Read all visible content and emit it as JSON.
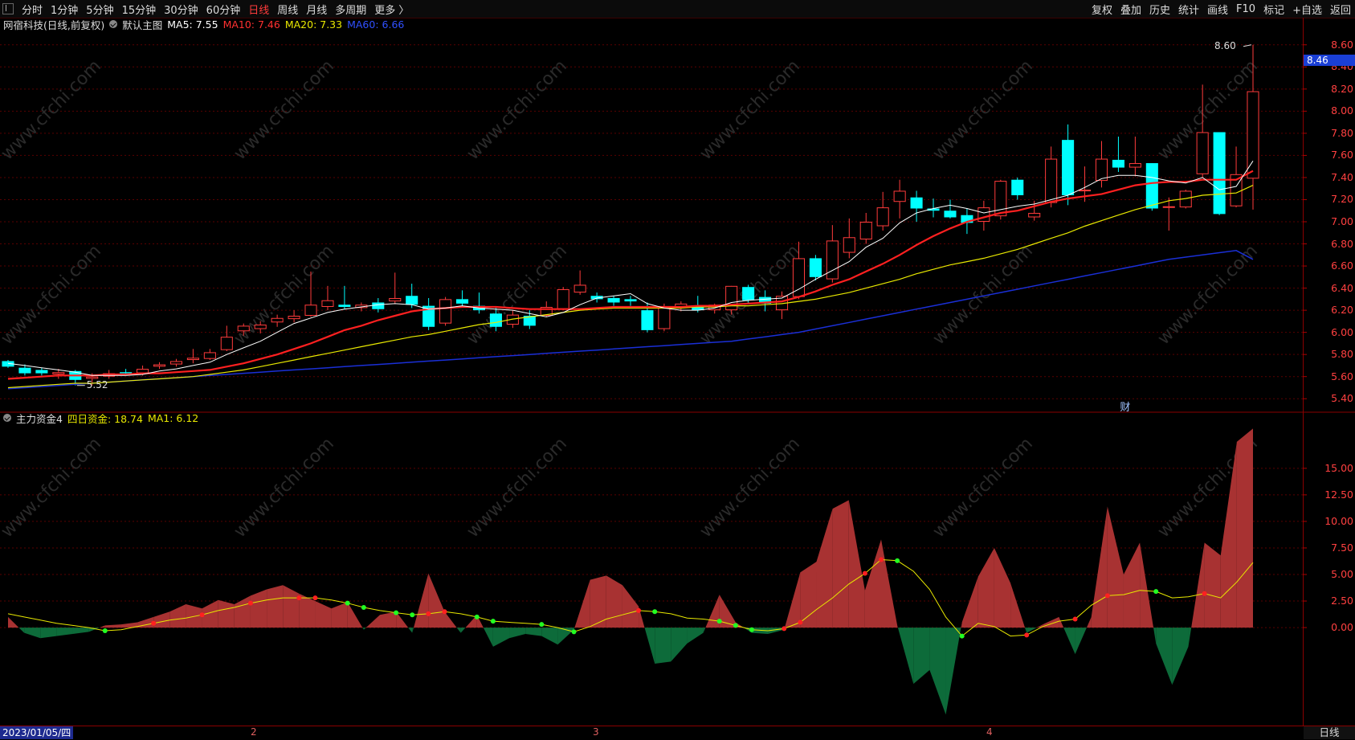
{
  "toolbar": {
    "periods": [
      "分时",
      "1分钟",
      "5分钟",
      "15分钟",
      "30分钟",
      "60分钟",
      "日线",
      "周线",
      "月线",
      "多周期",
      "更多 〉"
    ],
    "active_index": 6,
    "right_items": [
      "复权",
      "叠加",
      "历史",
      "统计",
      "画线",
      "F10",
      "标记",
      "+自选",
      "返回"
    ]
  },
  "main_info": {
    "stock": "网宿科技(日线,前复权)",
    "template": "默认主图",
    "ma5": "MA5: 7.55",
    "ma10": "MA10: 7.46",
    "ma20": "MA20: 7.33",
    "ma60": "MA60: 6.66"
  },
  "sub_info": {
    "indicator": "主力资金4",
    "fund": "四日资金: 18.74",
    "ma1": "MA1: 6.12"
  },
  "price_flag": "8.46",
  "high_marker": "8.60",
  "low_marker": "5.52",
  "finance_marker": "财",
  "bottom": {
    "date": "2023/01/05/四",
    "period": "日线",
    "month_ticks": [
      "2",
      "3",
      "4"
    ]
  },
  "watermark": "www.cfchi.com",
  "colors": {
    "up": "#ff3b3b",
    "down": "#00ffff",
    "ma5": "#ffffff",
    "ma10": "#ff2020",
    "ma20": "#e8e800",
    "ma60": "#1a2fd6",
    "fund_pos": "#a83232",
    "fund_neg": "#0d6b3a",
    "ma1": "#e8e800",
    "grid": "#5a0000"
  },
  "chart_data": [
    {
      "type": "candlestick",
      "title": "网宿科技(日线,前复权)",
      "ylim": [
        5.3,
        8.7
      ],
      "yticks": [
        5.4,
        5.6,
        5.8,
        6.0,
        6.2,
        6.4,
        6.6,
        6.8,
        7.0,
        7.2,
        7.4,
        7.6,
        7.8,
        8.0,
        8.2,
        8.4,
        8.6
      ],
      "candles": [
        [
          5.74,
          5.69,
          5.75,
          5.68
        ],
        [
          5.68,
          5.63,
          5.71,
          5.61
        ],
        [
          5.66,
          5.63,
          5.68,
          5.61
        ],
        [
          5.62,
          5.64,
          5.67,
          5.58
        ],
        [
          5.65,
          5.57,
          5.66,
          5.52
        ],
        [
          5.58,
          5.6,
          5.63,
          5.52
        ],
        [
          5.6,
          5.63,
          5.66,
          5.58
        ],
        [
          5.64,
          5.63,
          5.67,
          5.61
        ],
        [
          5.63,
          5.67,
          5.7,
          5.61
        ],
        [
          5.69,
          5.71,
          5.73,
          5.67
        ],
        [
          5.71,
          5.74,
          5.76,
          5.69
        ],
        [
          5.75,
          5.77,
          5.85,
          5.72
        ],
        [
          5.76,
          5.82,
          5.85,
          5.75
        ],
        [
          5.84,
          5.96,
          6.06,
          5.83
        ],
        [
          6.01,
          6.06,
          6.08,
          5.97
        ],
        [
          6.03,
          6.07,
          6.1,
          5.99
        ],
        [
          6.09,
          6.13,
          6.16,
          6.05
        ],
        [
          6.12,
          6.15,
          6.2,
          6.09
        ],
        [
          6.15,
          6.25,
          6.55,
          6.14
        ],
        [
          6.23,
          6.29,
          6.42,
          6.2
        ],
        [
          6.25,
          6.23,
          6.42,
          6.21
        ],
        [
          6.22,
          6.25,
          6.27,
          6.19
        ],
        [
          6.27,
          6.21,
          6.31,
          6.18
        ],
        [
          6.28,
          6.31,
          6.54,
          6.26
        ],
        [
          6.33,
          6.25,
          6.44,
          6.22
        ],
        [
          6.24,
          6.05,
          6.31,
          6.02
        ],
        [
          6.08,
          6.3,
          6.32,
          6.06
        ],
        [
          6.3,
          6.26,
          6.38,
          6.24
        ],
        [
          6.24,
          6.2,
          6.36,
          6.17
        ],
        [
          6.17,
          6.05,
          6.22,
          6.01
        ],
        [
          6.07,
          6.16,
          6.2,
          6.04
        ],
        [
          6.15,
          6.06,
          6.2,
          6.03
        ],
        [
          6.15,
          6.23,
          6.28,
          6.14
        ],
        [
          6.21,
          6.39,
          6.41,
          6.2
        ],
        [
          6.36,
          6.43,
          6.56,
          6.34
        ],
        [
          6.33,
          6.3,
          6.36,
          6.27
        ],
        [
          6.31,
          6.27,
          6.33,
          6.24
        ],
        [
          6.3,
          6.28,
          6.33,
          6.24
        ],
        [
          6.2,
          6.02,
          6.27,
          6.0
        ],
        [
          6.03,
          6.23,
          6.26,
          6.01
        ],
        [
          6.23,
          6.26,
          6.28,
          6.19
        ],
        [
          6.24,
          6.2,
          6.33,
          6.18
        ],
        [
          6.2,
          6.25,
          6.26,
          6.17
        ],
        [
          6.2,
          6.42,
          6.42,
          6.16
        ],
        [
          6.41,
          6.29,
          6.43,
          6.27
        ],
        [
          6.32,
          6.26,
          6.38,
          6.19
        ],
        [
          6.2,
          6.33,
          6.37,
          6.12
        ],
        [
          6.32,
          6.67,
          6.82,
          6.3
        ],
        [
          6.67,
          6.5,
          6.7,
          6.47
        ],
        [
          6.48,
          6.83,
          6.97,
          6.45
        ],
        [
          6.72,
          6.86,
          7.03,
          6.67
        ],
        [
          6.84,
          7.0,
          7.08,
          6.8
        ],
        [
          6.96,
          7.13,
          7.27,
          6.92
        ],
        [
          7.18,
          7.28,
          7.38,
          7.03
        ],
        [
          7.22,
          7.12,
          7.28,
          7.0
        ],
        [
          7.12,
          7.1,
          7.21,
          7.04
        ],
        [
          7.1,
          7.04,
          7.2,
          7.03
        ],
        [
          7.06,
          6.99,
          7.12,
          6.89
        ],
        [
          7.0,
          7.13,
          7.19,
          6.92
        ],
        [
          7.05,
          7.37,
          7.38,
          7.02
        ],
        [
          7.38,
          7.24,
          7.4,
          7.2
        ],
        [
          7.04,
          7.08,
          7.19,
          7.01
        ],
        [
          7.17,
          7.57,
          7.68,
          7.13
        ],
        [
          7.74,
          7.24,
          7.88,
          7.15
        ],
        [
          7.28,
          7.29,
          7.5,
          7.18
        ],
        [
          7.37,
          7.57,
          7.73,
          7.31
        ],
        [
          7.56,
          7.49,
          7.77,
          7.45
        ],
        [
          7.49,
          7.53,
          7.77,
          7.41
        ],
        [
          7.53,
          7.12,
          7.53,
          7.1
        ],
        [
          7.14,
          7.14,
          7.22,
          6.92
        ],
        [
          7.13,
          7.28,
          7.29,
          7.12
        ],
        [
          7.43,
          7.81,
          8.24,
          7.4
        ],
        [
          7.81,
          7.07,
          7.81,
          7.06
        ],
        [
          7.14,
          7.43,
          7.68,
          7.13
        ],
        [
          7.39,
          8.18,
          8.6,
          7.11
        ]
      ],
      "ma5": [
        5.72,
        5.7,
        5.68,
        5.66,
        5.64,
        5.61,
        5.61,
        5.61,
        5.62,
        5.65,
        5.67,
        5.7,
        5.73,
        5.8,
        5.86,
        5.92,
        6.0,
        6.08,
        6.13,
        6.18,
        6.21,
        6.23,
        6.25,
        6.26,
        6.25,
        6.21,
        6.22,
        6.24,
        6.22,
        6.21,
        6.2,
        6.17,
        6.14,
        6.18,
        6.25,
        6.31,
        6.33,
        6.35,
        6.26,
        6.22,
        6.2,
        6.2,
        6.22,
        6.27,
        6.29,
        6.3,
        6.31,
        6.39,
        6.48,
        6.56,
        6.64,
        6.77,
        6.85,
        6.99,
        7.08,
        7.12,
        7.15,
        7.12,
        7.08,
        7.11,
        7.14,
        7.16,
        7.2,
        7.24,
        7.31,
        7.39,
        7.42,
        7.42,
        7.4,
        7.37,
        7.35,
        7.4,
        7.29,
        7.32,
        7.55
      ],
      "ma10": [
        5.58,
        5.59,
        5.6,
        5.61,
        5.61,
        5.61,
        5.62,
        5.62,
        5.63,
        5.63,
        5.64,
        5.65,
        5.66,
        5.69,
        5.72,
        5.76,
        5.8,
        5.85,
        5.9,
        5.96,
        6.02,
        6.06,
        6.11,
        6.15,
        6.19,
        6.21,
        6.22,
        6.23,
        6.23,
        6.23,
        6.22,
        6.21,
        6.21,
        6.21,
        6.21,
        6.22,
        6.23,
        6.23,
        6.23,
        6.23,
        6.23,
        6.24,
        6.24,
        6.25,
        6.26,
        6.27,
        6.28,
        6.32,
        6.37,
        6.43,
        6.48,
        6.55,
        6.62,
        6.7,
        6.79,
        6.87,
        6.94,
        7.0,
        7.04,
        7.08,
        7.1,
        7.14,
        7.18,
        7.21,
        7.23,
        7.25,
        7.29,
        7.33,
        7.35,
        7.36,
        7.36,
        7.38,
        7.38,
        7.38,
        7.46
      ],
      "ma20": [
        5.5,
        5.51,
        5.52,
        5.53,
        5.54,
        5.54,
        5.55,
        5.56,
        5.57,
        5.58,
        5.59,
        5.6,
        5.62,
        5.64,
        5.66,
        5.69,
        5.72,
        5.75,
        5.78,
        5.81,
        5.84,
        5.87,
        5.9,
        5.93,
        5.96,
        5.98,
        6.01,
        6.04,
        6.07,
        6.09,
        6.12,
        6.14,
        6.16,
        6.18,
        6.2,
        6.21,
        6.22,
        6.22,
        6.22,
        6.22,
        6.22,
        6.23,
        6.23,
        6.24,
        6.24,
        6.25,
        6.26,
        6.28,
        6.3,
        6.33,
        6.36,
        6.4,
        6.44,
        6.48,
        6.53,
        6.57,
        6.61,
        6.64,
        6.67,
        6.71,
        6.75,
        6.8,
        6.85,
        6.9,
        6.96,
        7.01,
        7.06,
        7.11,
        7.15,
        7.19,
        7.21,
        7.24,
        7.25,
        7.26,
        7.33
      ],
      "ma60": [
        5.49,
        5.5,
        5.51,
        5.52,
        5.53,
        5.54,
        5.55,
        5.56,
        5.57,
        5.58,
        5.59,
        5.6,
        5.61,
        5.62,
        5.63,
        5.64,
        5.65,
        5.66,
        5.67,
        5.68,
        5.69,
        5.7,
        5.71,
        5.72,
        5.73,
        5.74,
        5.75,
        5.76,
        5.77,
        5.78,
        5.79,
        5.8,
        5.81,
        5.82,
        5.83,
        5.84,
        5.85,
        5.86,
        5.87,
        5.88,
        5.89,
        5.9,
        5.91,
        5.92,
        5.94,
        5.96,
        5.98,
        6.0,
        6.03,
        6.06,
        6.09,
        6.12,
        6.15,
        6.18,
        6.21,
        6.24,
        6.27,
        6.3,
        6.33,
        6.36,
        6.39,
        6.42,
        6.45,
        6.48,
        6.51,
        6.54,
        6.57,
        6.6,
        6.63,
        6.66,
        6.68,
        6.7,
        6.72,
        6.74,
        6.66
      ]
    },
    {
      "type": "area",
      "title": "主力资金4",
      "ylim": [
        -9.0,
        19.0
      ],
      "yticks": [
        0.0,
        2.5,
        5.0,
        7.5,
        10.0,
        12.5,
        15.0
      ],
      "series": [
        {
          "name": "四日资金",
          "values": [
            1.0,
            -0.5,
            -1.0,
            -0.8,
            -0.6,
            -0.4,
            0.2,
            0.3,
            0.5,
            1.0,
            1.5,
            2.2,
            1.8,
            2.6,
            2.2,
            3.0,
            3.6,
            4.0,
            3.2,
            2.5,
            1.8,
            2.4,
            -0.2,
            1.2,
            1.5,
            -0.5,
            5.1,
            1.5,
            -0.5,
            1.2,
            -1.8,
            -1.0,
            -0.6,
            -0.8,
            -1.6,
            -0.2,
            4.5,
            4.9,
            4.0,
            2.0,
            -3.4,
            -3.2,
            -1.5,
            -0.5,
            3.1,
            0.5,
            -0.5,
            -0.6,
            -0.2,
            5.2,
            6.2,
            11.2,
            12.0,
            3.5,
            8.3,
            0.2,
            -5.3,
            -4.0,
            -8.2,
            0.5,
            4.8,
            7.5,
            4.2,
            -0.5,
            0.3,
            1.0,
            -2.5,
            1.0,
            11.4,
            5.0,
            8.0,
            -1.5,
            -5.4,
            -1.8,
            8.0,
            6.8,
            17.5,
            18.74
          ]
        },
        {
          "name": "MA1",
          "values": [
            1.3,
            1.0,
            0.7,
            0.4,
            0.2,
            0.0,
            -0.3,
            -0.2,
            0.1,
            0.4,
            0.7,
            0.9,
            1.2,
            1.6,
            1.9,
            2.3,
            2.6,
            2.8,
            2.8,
            2.8,
            2.6,
            2.3,
            1.9,
            1.6,
            1.4,
            1.2,
            1.3,
            1.5,
            1.3,
            1.0,
            0.6,
            0.5,
            0.4,
            0.3,
            0.0,
            -0.4,
            0.1,
            0.8,
            1.2,
            1.6,
            1.5,
            1.3,
            0.9,
            0.8,
            0.6,
            0.2,
            -0.2,
            -0.3,
            -0.1,
            0.5,
            1.7,
            2.8,
            4.1,
            5.1,
            6.4,
            6.3,
            5.3,
            3.6,
            1.0,
            -0.8,
            0.4,
            0.1,
            -0.8,
            -0.7,
            0.1,
            0.6,
            0.8,
            2.1,
            3.0,
            3.1,
            3.5,
            3.4,
            2.8,
            2.9,
            3.2,
            2.8,
            4.3,
            6.12
          ]
        }
      ]
    }
  ]
}
